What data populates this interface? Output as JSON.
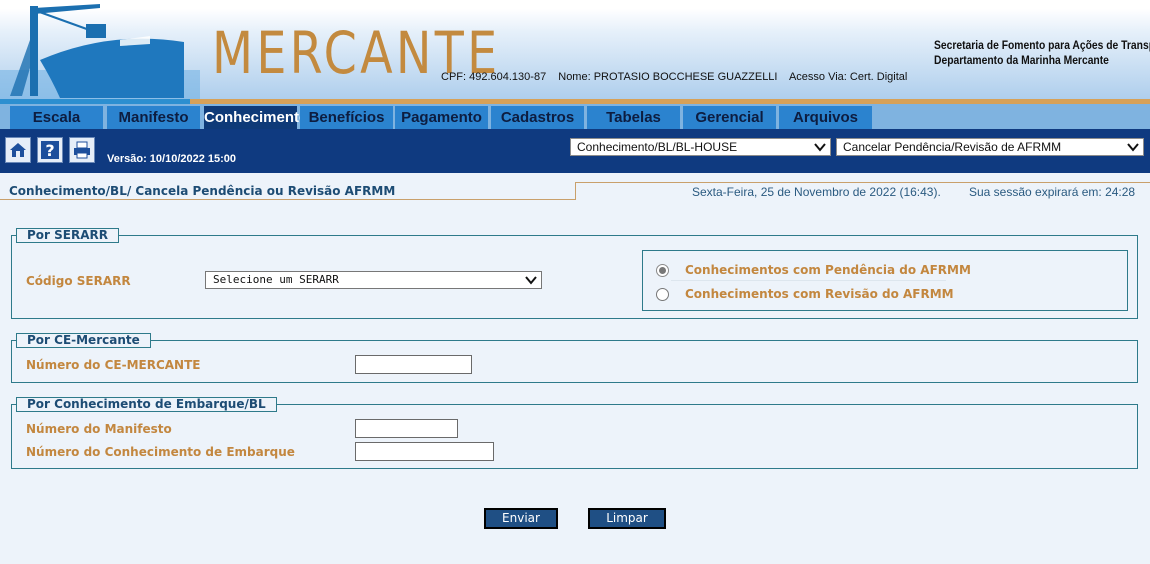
{
  "header": {
    "logo_text": "MERCANTE",
    "cpf": "CPF: 492.604.130-87",
    "nome": "Nome: PROTASIO BOCCHESE GUAZZELLI",
    "acesso": "Acesso Via: Cert. Digital",
    "secretaria_line1": "Secretaria de Fomento para Ações de Transportes",
    "secretaria_line2": "Departamento da Marinha Mercante"
  },
  "nav": {
    "tabs": [
      {
        "label": "Escala"
      },
      {
        "label": "Manifesto"
      },
      {
        "label": "Conhecimento",
        "active": true
      },
      {
        "label": "Benefícios"
      },
      {
        "label": "Pagamento"
      },
      {
        "label": "Cadastros"
      },
      {
        "label": "Tabelas"
      },
      {
        "label": "Gerencial"
      },
      {
        "label": "Arquivos"
      }
    ]
  },
  "toolbar": {
    "icons": [
      "home-icon",
      "help-icon",
      "print-icon"
    ],
    "version": "Versão: 10/10/2022 15:00",
    "select_module": "Conhecimento/BL/BL-HOUSE",
    "select_action": "Cancelar Pendência/Revisão de AFRMM"
  },
  "page": {
    "title": "Conhecimento/BL/ Cancela Pendência ou Revisão AFRMM",
    "date": "Sexta-Feira, 25 de Novembro de 2022 (16:43).",
    "session": "Sua sessão expirará em: 24:28"
  },
  "serarr": {
    "legend": "Por SERARR",
    "label": "Código SERARR",
    "select_value": "Selecione um SERARR",
    "radio_pendencia": "Conhecimentos com Pendência do AFRMM",
    "radio_revisao": "Conhecimentos com Revisão do AFRMM",
    "selected": "pendencia"
  },
  "ce": {
    "legend": "Por CE-Mercante",
    "label": "Número do CE-MERCANTE",
    "value": ""
  },
  "bl": {
    "legend": "Por Conhecimento de Embarque/BL",
    "manifesto_label": "Número do Manifesto",
    "manifesto_value": "",
    "conhecimento_label": "Número do Conhecimento de Embarque",
    "conhecimento_value": ""
  },
  "actions": {
    "enviar": "Enviar",
    "limpar": "Limpar"
  },
  "colors": {
    "accent": "#0f3a80",
    "label_orange": "#c3873f",
    "tab_blue": "#2b83cf"
  }
}
